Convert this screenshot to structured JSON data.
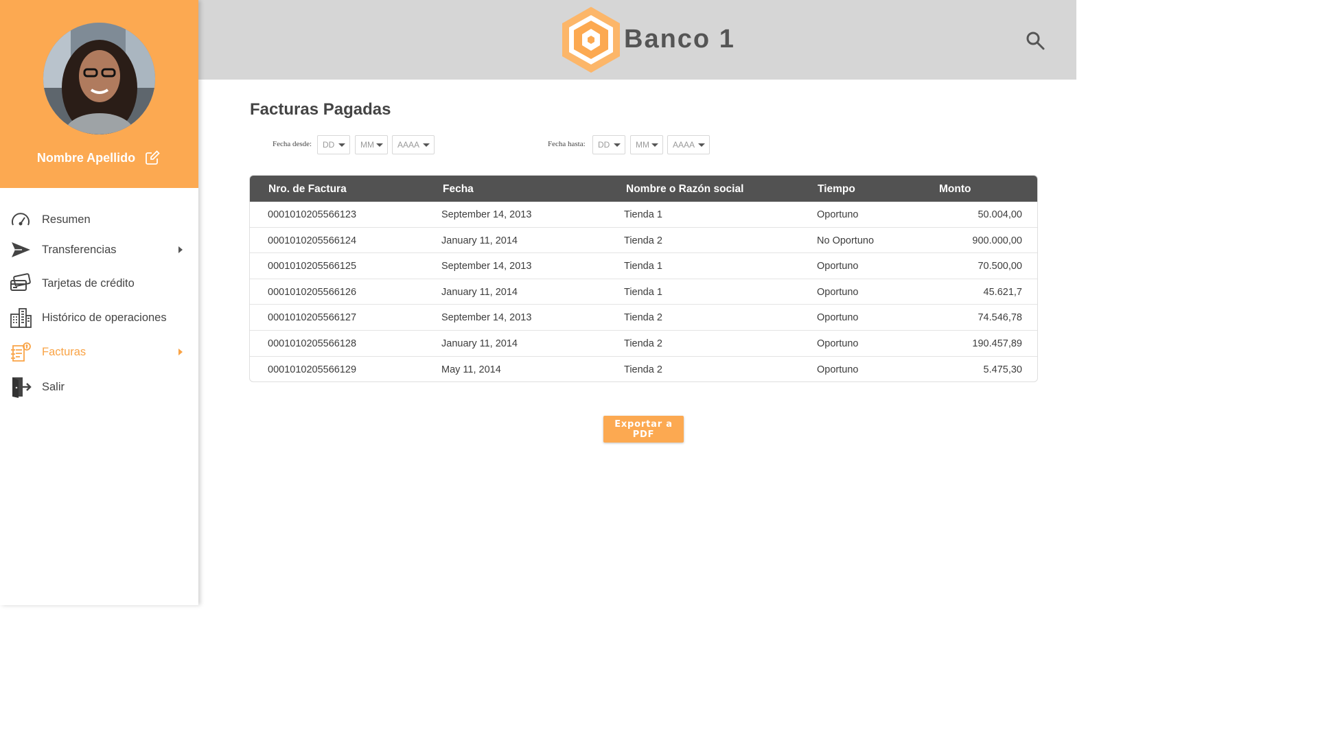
{
  "user": {
    "name": "Nombre Apellido"
  },
  "brand": {
    "name": "Banco 1"
  },
  "colors": {
    "accent": "#fca951",
    "header_bg": "#d6d6d6",
    "table_header_bg": "#525252"
  },
  "nav": [
    {
      "label": "Resumen",
      "icon": "speedometer-icon",
      "arrow": false,
      "active": false
    },
    {
      "label": "Transferencias",
      "icon": "send-icon",
      "arrow": true,
      "active": false
    },
    {
      "label": "Tarjetas de crédito",
      "icon": "credit-cards-icon",
      "arrow": false,
      "active": false
    },
    {
      "label": "Histórico de operaciones",
      "icon": "buildings-icon",
      "arrow": false,
      "active": false
    },
    {
      "label": "Facturas",
      "icon": "invoice-icon",
      "arrow": true,
      "active": true
    },
    {
      "label": "Salir",
      "icon": "exit-door-icon",
      "arrow": false,
      "active": false
    }
  ],
  "page": {
    "title": "Facturas Pagadas"
  },
  "filters": {
    "from_label": "Fecha desde:",
    "to_label": "Fecha hasta:",
    "day_placeholder": "DD",
    "month_placeholder": "MM",
    "year_placeholder": "AAAA"
  },
  "table": {
    "headers": [
      "Nro. de Factura",
      "Fecha",
      "Nombre o Razón social",
      "Tiempo",
      "Monto"
    ],
    "rows": [
      [
        "0001010205566123",
        "September 14, 2013",
        "Tienda 1",
        "Oportuno",
        "50.004,00"
      ],
      [
        "0001010205566124",
        "January 11, 2014",
        "Tienda 2",
        "No Oportuno",
        "900.000,00"
      ],
      [
        "0001010205566125",
        "September 14, 2013",
        "Tienda 1",
        "Oportuno",
        "70.500,00"
      ],
      [
        "0001010205566126",
        "January 11, 2014",
        "Tienda 1",
        "Oportuno",
        "45.621,7"
      ],
      [
        "0001010205566127",
        "September 14, 2013",
        "Tienda 2",
        "Oportuno",
        "74.546,78"
      ],
      [
        "0001010205566128",
        "January 11, 2014",
        "Tienda 2",
        "Oportuno",
        "190.457,89"
      ],
      [
        "0001010205566129",
        "May 11, 2014",
        "Tienda 2",
        "Oportuno",
        "5.475,30"
      ]
    ]
  },
  "actions": {
    "export_label": "Exportar a PDF"
  }
}
